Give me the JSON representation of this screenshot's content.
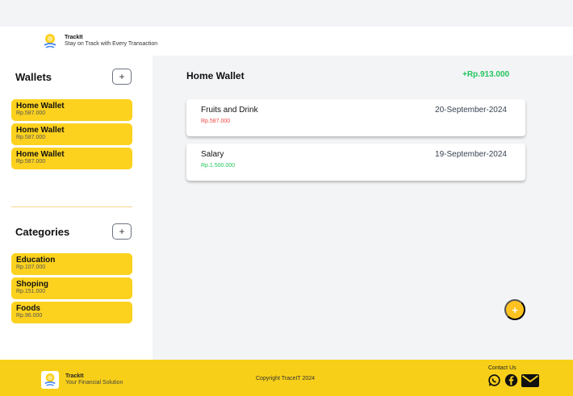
{
  "header": {
    "app_name": "TrackIt",
    "tagline": "Stay on Track with Every Transaction"
  },
  "sidebar": {
    "wallets_title": "Wallets",
    "add_wallet_label": "+",
    "wallets": [
      {
        "name": "Home Wallet",
        "amount": "Rp.587.000"
      },
      {
        "name": "Home Wallet",
        "amount": "Rp.587.000"
      },
      {
        "name": "Home Wallet",
        "amount": "Rp.587.000"
      }
    ],
    "categories_title": "Categories",
    "add_category_label": "+",
    "categories": [
      {
        "name": "Education",
        "amount": "Rp.107.000"
      },
      {
        "name": "Shoping",
        "amount": "Rp.151.000"
      },
      {
        "name": "Foods",
        "amount": "Rp.96.000"
      }
    ]
  },
  "main": {
    "title": "Home Wallet",
    "balance": "+Rp.913.000",
    "transactions": [
      {
        "name": "Fruits and Drink",
        "amount": "Rp.587.000",
        "date": "20-September-2024",
        "type": "expense"
      },
      {
        "name": "Salary",
        "amount": "Rp.1.500.000",
        "date": "19-September-2024",
        "type": "income"
      }
    ],
    "fab_label": "+"
  },
  "footer": {
    "app_name": "TrackIt",
    "tagline": "Your Financial Solution",
    "copyright": "Copyright TraceIT 2024",
    "contact_label": "Contact Us",
    "socials": [
      "whatsapp-icon",
      "facebook-icon",
      "mail-icon"
    ]
  },
  "colors": {
    "accent": "#fcd21f",
    "income": "#22c55e",
    "expense": "#ef4444",
    "footer": "#f7cf19"
  }
}
